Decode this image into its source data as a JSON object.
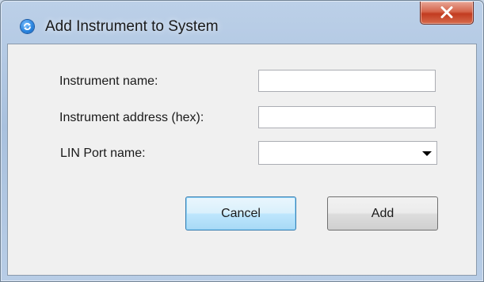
{
  "window": {
    "title": "Add Instrument to System",
    "icon": "refresh-circle-icon",
    "close_icon": "close-x-icon"
  },
  "form": {
    "name_label": "Instrument name:",
    "name_value": "",
    "address_label": "Instrument address (hex):",
    "address_value": "",
    "port_label": "LIN Port name:",
    "port_value": ""
  },
  "buttons": {
    "cancel_label": "Cancel",
    "add_label": "Add"
  },
  "colors": {
    "close_button": "#c94a2f",
    "default_button_border": "#3c7fb1",
    "dialog_background": "#f0f0f0"
  }
}
